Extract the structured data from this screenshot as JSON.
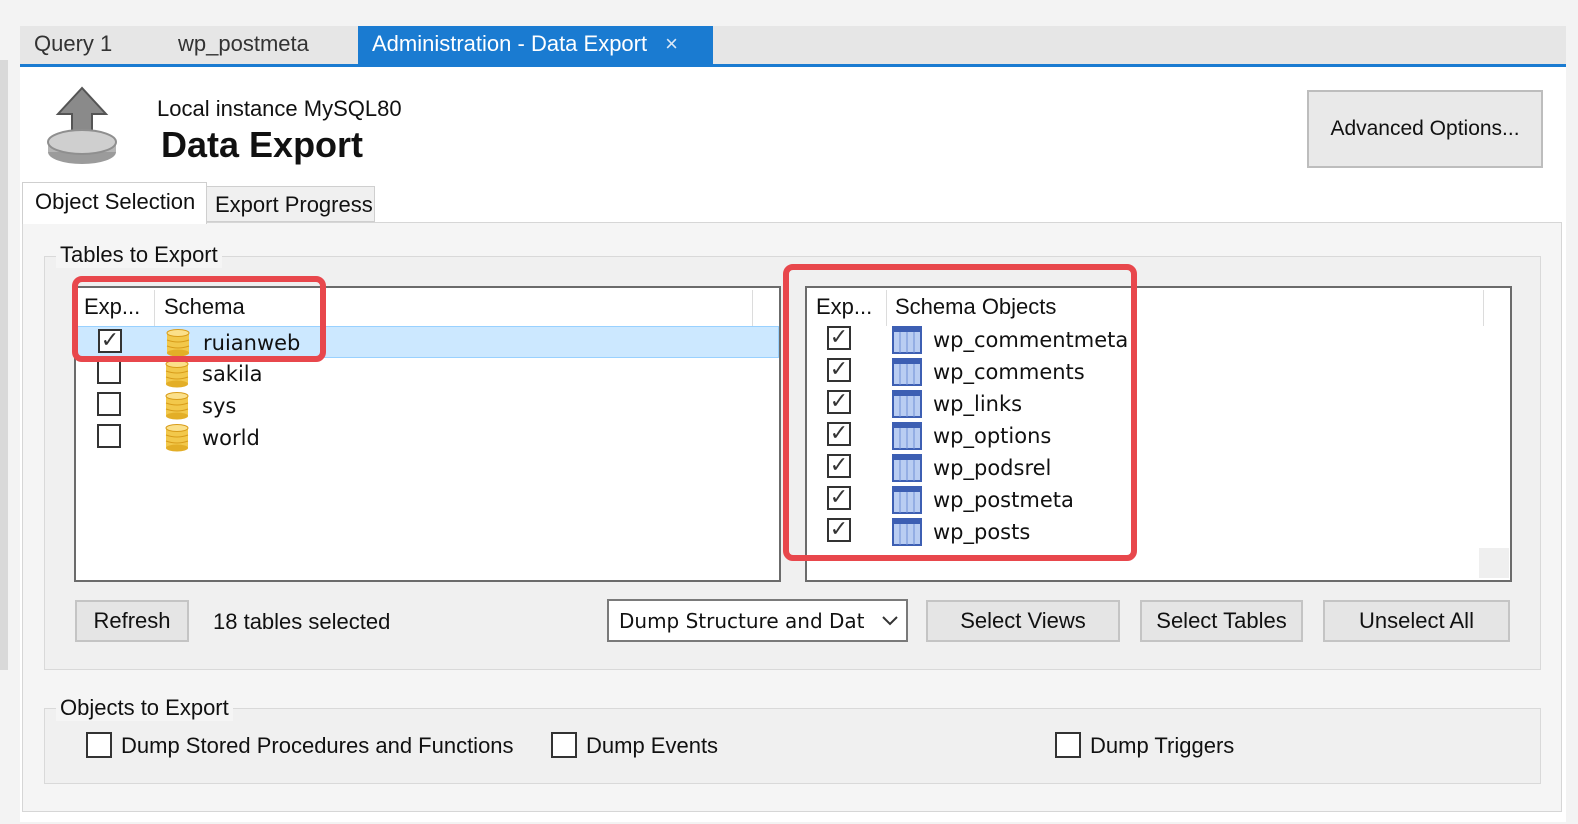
{
  "doc_tabs": [
    {
      "label": "Query 1"
    },
    {
      "label": "wp_postmeta"
    },
    {
      "label": "Administration - Data Export",
      "close": "×"
    }
  ],
  "header": {
    "instance": "Local instance MySQL80",
    "title": "Data Export",
    "advanced_button": "Advanced Options..."
  },
  "page_tabs": [
    "Object Selection",
    "Export Progress"
  ],
  "tables_group": {
    "title": "Tables to Export",
    "schema_list": {
      "col_export": "Exp...",
      "col_schema": "Schema",
      "rows": [
        {
          "name": "ruianweb",
          "checked": true,
          "selected": true
        },
        {
          "name": "sakila",
          "checked": false
        },
        {
          "name": "sys",
          "checked": false
        },
        {
          "name": "world",
          "checked": false
        }
      ]
    },
    "objects_list": {
      "col_export": "Exp...",
      "col_objects": "Schema Objects",
      "rows": [
        {
          "name": "wp_commentmeta",
          "checked": true
        },
        {
          "name": "wp_comments",
          "checked": true
        },
        {
          "name": "wp_links",
          "checked": true
        },
        {
          "name": "wp_options",
          "checked": true
        },
        {
          "name": "wp_podsrel",
          "checked": true
        },
        {
          "name": "wp_postmeta",
          "checked": true
        },
        {
          "name": "wp_posts",
          "checked": true
        }
      ]
    },
    "refresh_button": "Refresh",
    "status": "18 tables selected",
    "dump_mode": "Dump Structure and Dat",
    "select_views_button": "Select Views",
    "select_tables_button": "Select Tables",
    "unselect_all_button": "Unselect All"
  },
  "objects_group": {
    "title": "Objects to Export",
    "options": [
      {
        "label": "Dump Stored Procedures and Functions",
        "checked": false
      },
      {
        "label": "Dump Events",
        "checked": false
      },
      {
        "label": "Dump Triggers",
        "checked": false
      }
    ]
  },
  "colors": {
    "accent": "#1a7bd1",
    "highlight": "#e8474c",
    "selected_row": "#cce8ff"
  }
}
